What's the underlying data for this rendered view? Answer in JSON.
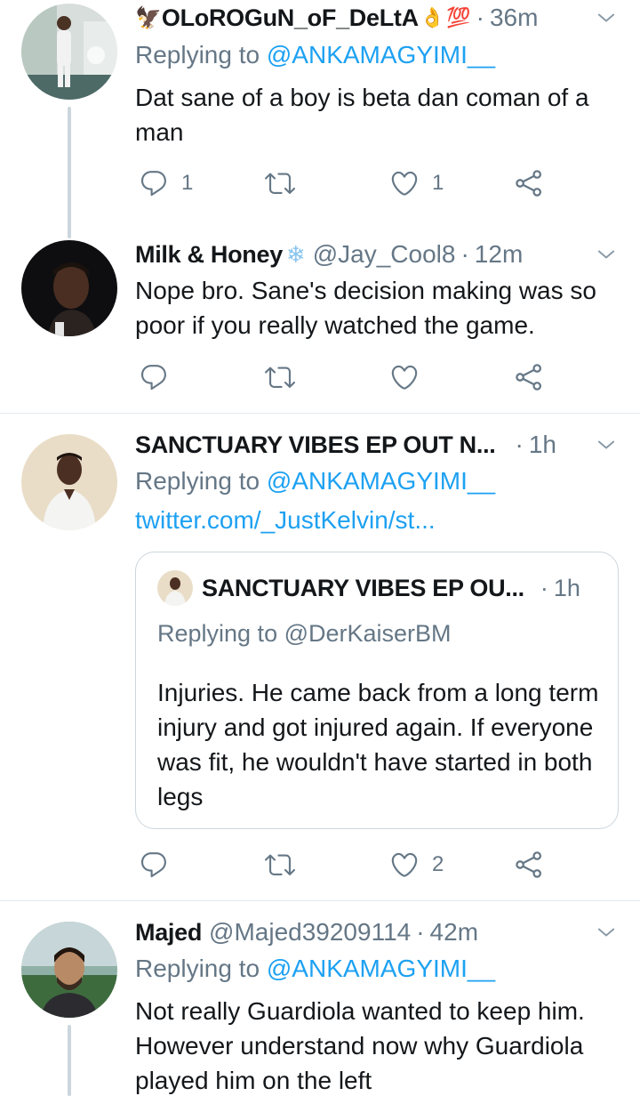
{
  "colors": {
    "accent": "#1da1f2",
    "muted": "#657786",
    "text": "#14171a",
    "border": "#e1e8ed",
    "thread": "#ccd6dd"
  },
  "tweets": [
    {
      "name": "OLoROGuN_oF_DeLtA",
      "handle": "",
      "time": "36m",
      "reply_prefix": "Replying to ",
      "reply_mention": "@ANKAMAGYIMI__",
      "text": "Dat sane of a boy is beta dan coman of a man",
      "reply_count": "1",
      "retweet_count": "",
      "like_count": "1"
    },
    {
      "name": "Milk & Honey",
      "handle": "@Jay_Cool8",
      "time": "12m",
      "text": "Nope bro. Sane's decision making was so poor if you really watched the game.",
      "reply_count": "",
      "retweet_count": "",
      "like_count": ""
    },
    {
      "name": "SANCTUARY VIBES EP OUT N...",
      "time": "1h",
      "reply_prefix": "Replying to ",
      "reply_mention": "@ANKAMAGYIMI__",
      "link": "twitter.com/_JustKelvin/st...",
      "quote": {
        "name": "SANCTUARY VIBES EP OU...",
        "time": "1h",
        "reply_line": "Replying to @DerKaiserBM",
        "text": "Injuries. He came back from a long term injury and got injured again. If everyone was fit, he wouldn't have started in both legs"
      },
      "reply_count": "",
      "retweet_count": "",
      "like_count": "2"
    },
    {
      "name": "Majed",
      "handle": "@Majed39209114",
      "time": "42m",
      "reply_prefix": "Replying to ",
      "reply_mention": "@ANKAMAGYIMI__",
      "text": "Not really Guardiola wanted to keep him. However understand now why Guardiola played him on the left"
    }
  ],
  "dot": "·",
  "icons": [
    "chevron-down-icon",
    "reply-icon",
    "retweet-icon",
    "like-icon",
    "share-icon",
    "snowflake-icon",
    "ok-hand-icon",
    "hundred-icon",
    "eagle-icon"
  ]
}
